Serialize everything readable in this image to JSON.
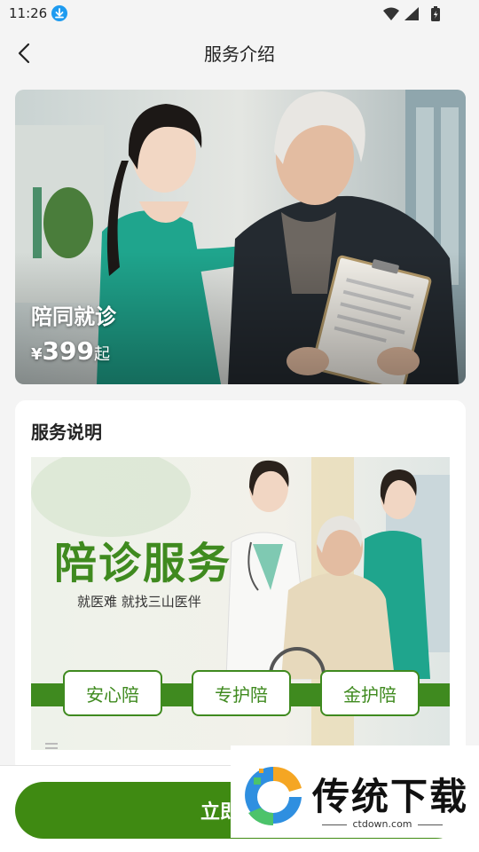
{
  "status_bar": {
    "time": "11:26"
  },
  "header": {
    "title": "服务介绍"
  },
  "hero": {
    "service_name": "陪同就诊",
    "currency": "¥",
    "price": "399",
    "price_suffix": "起"
  },
  "description": {
    "section_title": "服务说明",
    "banner": {
      "title": "陪诊服务",
      "subtitle": "就医难 就找三山医伴",
      "tags": [
        "安心陪",
        "专护陪",
        "金护陪"
      ]
    }
  },
  "footer": {
    "cta_label": "立即预约"
  },
  "watermark": {
    "text": "传统下载",
    "url": "ctdown.com"
  },
  "colors": {
    "brand_green": "#3f8a12",
    "scrub_teal": "#1fa58d"
  }
}
